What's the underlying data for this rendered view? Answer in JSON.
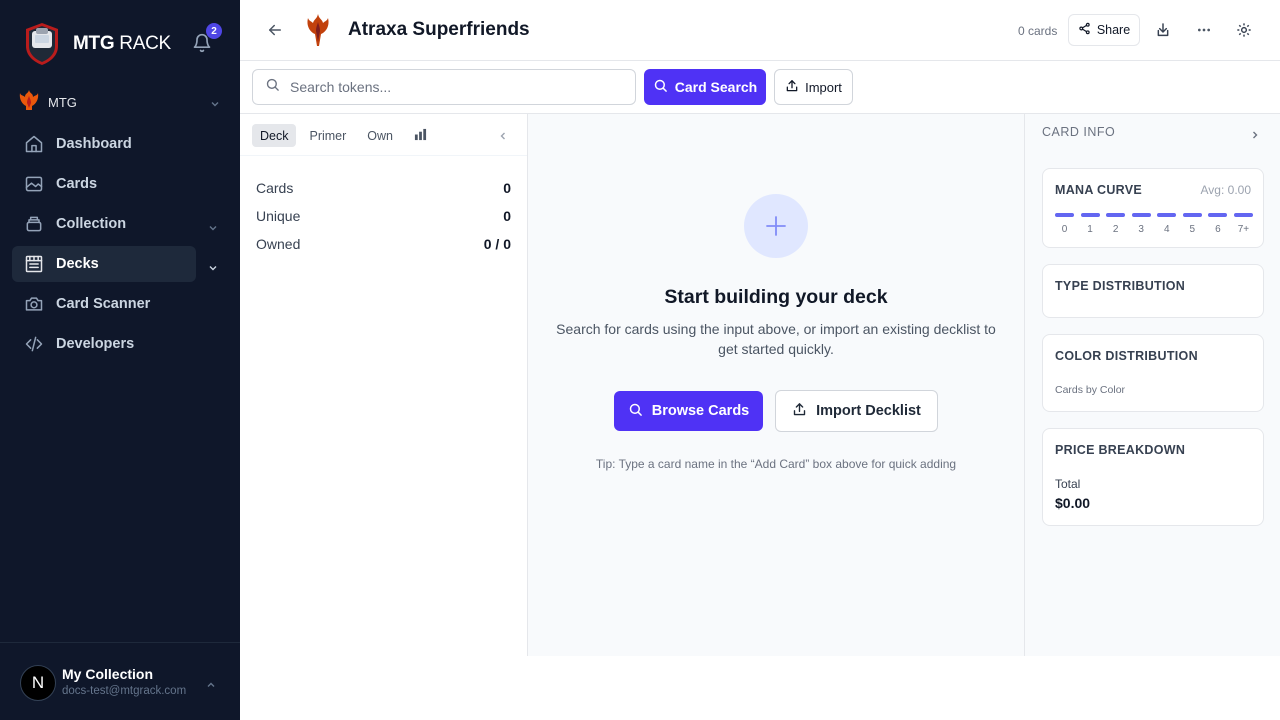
{
  "sidebar": {
    "logo_bold": "MTG",
    "logo_rest": " RACK",
    "notification_count": "2",
    "game": "MTG",
    "items": [
      {
        "label": "Dashboard",
        "icon": "home-icon"
      },
      {
        "label": "Cards",
        "icon": "image-icon"
      },
      {
        "label": "Collection",
        "icon": "box-icon",
        "expandable": true
      },
      {
        "label": "Decks",
        "icon": "deck-icon",
        "expandable": true,
        "active": true
      },
      {
        "label": "Card Scanner",
        "icon": "camera-icon"
      },
      {
        "label": "Developers",
        "icon": "code-icon"
      }
    ],
    "user": {
      "avatar_letter": "N",
      "name": "My Collection",
      "email": "docs-test@mtgrack.com"
    }
  },
  "header": {
    "deck_title": "Atraxa Superfriends",
    "card_count": "0 cards",
    "share_label": "Share"
  },
  "toolbar": {
    "search_placeholder": "Search tokens...",
    "card_search_label": "Card Search",
    "import_label": "Import"
  },
  "left_panel": {
    "tabs": [
      "Deck",
      "Primer",
      "Own"
    ],
    "active_tab": "Deck",
    "stats": [
      {
        "label": "Cards",
        "value": "0"
      },
      {
        "label": "Unique",
        "value": "0"
      },
      {
        "label": "Owned",
        "value": "0 / 0"
      }
    ]
  },
  "center": {
    "title": "Start building your deck",
    "description": "Search for cards using the input above, or import an existing decklist to get started quickly.",
    "browse_label": "Browse Cards",
    "import_decklist_label": "Import Decklist",
    "tip": "Tip: Type a card name in the “Add Card” box above for quick adding"
  },
  "right_panel": {
    "title": "CARD INFO",
    "mana_curve": {
      "title": "MANA CURVE",
      "avg": "Avg: 0.00",
      "labels": [
        "0",
        "1",
        "2",
        "3",
        "4",
        "5",
        "6",
        "7+"
      ]
    },
    "type_distribution": {
      "title": "TYPE DISTRIBUTION"
    },
    "color_distribution": {
      "title": "COLOR DISTRIBUTION",
      "subtitle": "Cards by Color"
    },
    "price_breakdown": {
      "title": "PRICE BREAKDOWN",
      "total_label": "Total",
      "total_value": "$0.00"
    }
  },
  "colors": {
    "sidebar_bg": "#0f172a",
    "accent": "#4f32f5",
    "mana_bar": "#6366f1",
    "brand_red": "#c2410c"
  }
}
